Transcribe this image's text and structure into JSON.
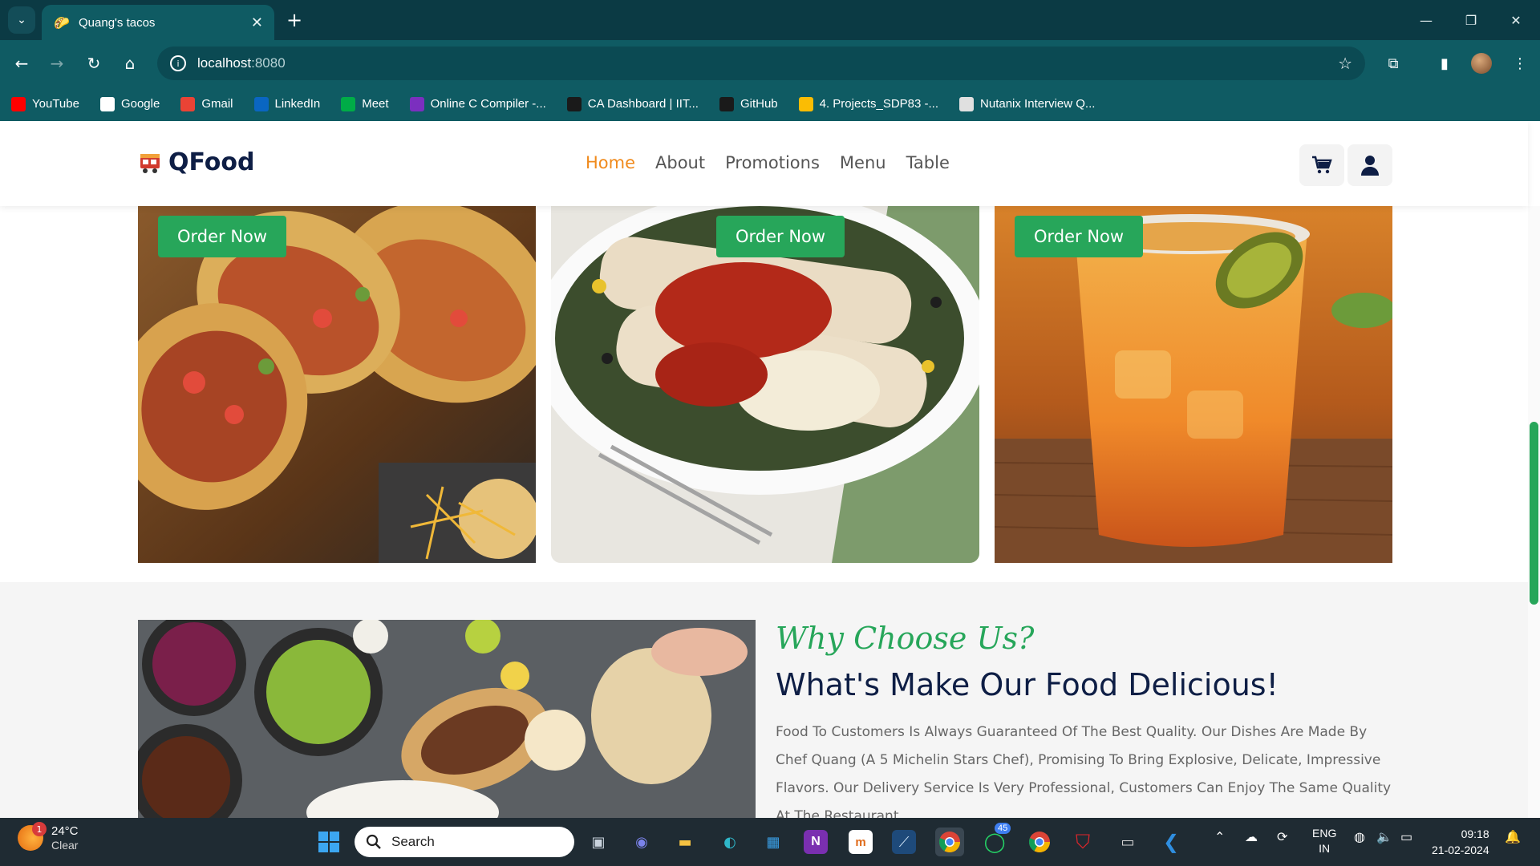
{
  "browser": {
    "tab_title": "Quang's tacos",
    "url_host": "localhost",
    "url_port": ":8080",
    "bookmarks": [
      {
        "label": "YouTube",
        "icon": "youtube-icon",
        "color": "#ff0000"
      },
      {
        "label": "Google",
        "icon": "google-icon",
        "color": "#ffffff"
      },
      {
        "label": "Gmail",
        "icon": "gmail-icon",
        "color": "#ea4335"
      },
      {
        "label": "LinkedIn",
        "icon": "linkedin-icon",
        "color": "#0a66c2"
      },
      {
        "label": "Meet",
        "icon": "meet-icon",
        "color": "#00ac47"
      },
      {
        "label": "Online C Compiler -...",
        "icon": "compiler-icon",
        "color": "#7b2fbf"
      },
      {
        "label": "CA Dashboard | IIT...",
        "icon": "dashboard-icon",
        "color": "#1a1a1a"
      },
      {
        "label": "GitHub",
        "icon": "github-icon",
        "color": "#1a1a1a"
      },
      {
        "label": "4. Projects_SDP83 -...",
        "icon": "drive-icon",
        "color": "#fbbc04"
      },
      {
        "label": "Nutanix Interview Q...",
        "icon": "nutanix-icon",
        "color": "#e0e0e0"
      }
    ]
  },
  "site": {
    "brand": "QFood",
    "nav": [
      "Home",
      "About",
      "Promotions",
      "Menu",
      "Table"
    ],
    "active_nav": "Home",
    "accent_color": "#27a65a",
    "nav_active_color": "#f08a1c",
    "cards": [
      {
        "button": "Order Now",
        "image": "tacos-photo"
      },
      {
        "button": "Order Now",
        "image": "enchiladas-photo"
      },
      {
        "button": "Order Now",
        "image": "drink-photo"
      }
    ],
    "why": {
      "tagline": "Why Choose Us?",
      "headline": "What's Make Our Food Delicious!",
      "description": "Food To Customers Is Always Guaranteed Of The Best Quality. Our Dishes Are Made By Chef Quang (A 5 Michelin Stars Chef), Promising To Bring Explosive, Delicate, Impressive Flavors. Our Delivery Service Is Very Professional, Customers Can Enjoy The Same Quality At The Restaurant"
    }
  },
  "taskbar": {
    "temp": "24°C",
    "condition": "Clear",
    "weather_badge": "1",
    "search_placeholder": "Search",
    "whatsapp_badge": "45",
    "lang_1": "ENG",
    "lang_2": "IN",
    "time": "09:18",
    "date": "21-02-2024"
  }
}
